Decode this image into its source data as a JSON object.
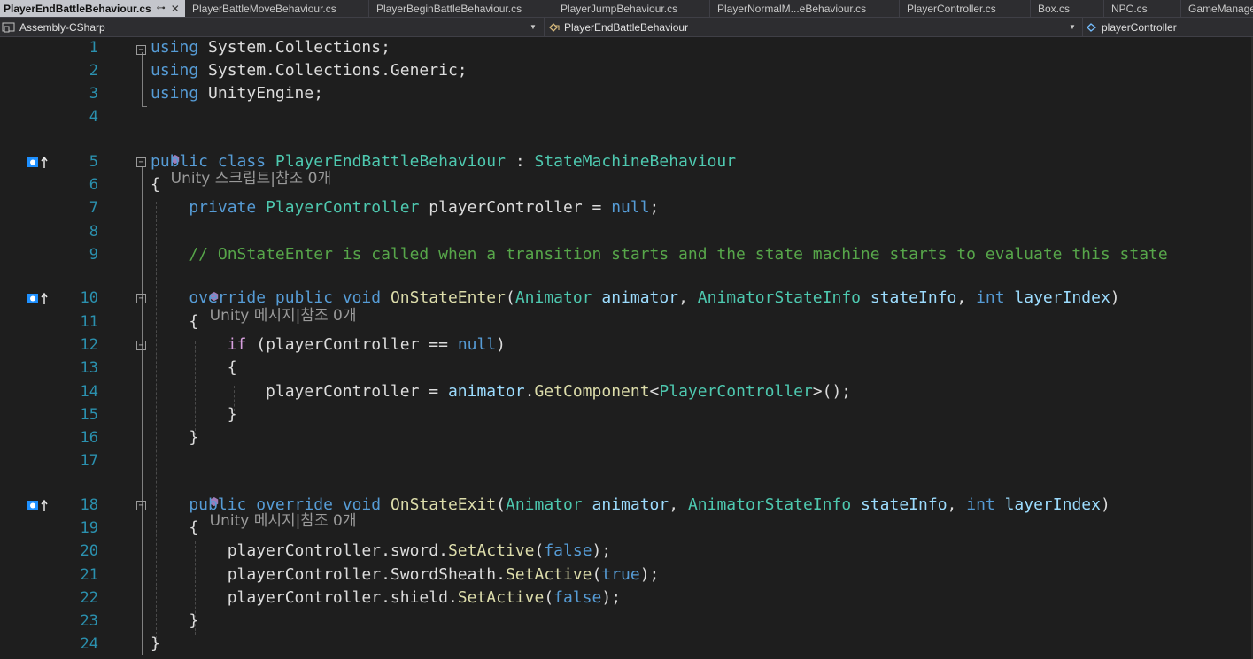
{
  "tabs": [
    {
      "label": "PlayerEndBattleBehaviour.cs",
      "active": true,
      "pin": "⊶",
      "close": "✕"
    },
    {
      "label": "PlayerBattleMoveBehaviour.cs"
    },
    {
      "label": "PlayerBeginBattleBehaviour.cs"
    },
    {
      "label": "PlayerJumpBehaviour.cs"
    },
    {
      "label": "PlayerNormalM...eBehaviour.cs"
    },
    {
      "label": "PlayerController.cs"
    },
    {
      "label": "Box.cs"
    },
    {
      "label": "NPC.cs"
    },
    {
      "label": "GameManage"
    }
  ],
  "nav": {
    "project": "Assembly-CSharp",
    "class": "PlayerEndBattleBehaviour",
    "member": "playerController"
  },
  "codelens": {
    "class": "Unity 스크립트|참조 0개",
    "enter": "Unity 메시지|참조 0개",
    "exit": "Unity 메시지|참조 0개"
  },
  "line_numbers": [
    "1",
    "2",
    "3",
    "4",
    "5",
    "6",
    "7",
    "8",
    "9",
    "10",
    "11",
    "12",
    "13",
    "14",
    "15",
    "16",
    "17",
    "18",
    "19",
    "20",
    "21",
    "22",
    "23",
    "24"
  ],
  "code": {
    "l1": [
      "using",
      " System.Collections;"
    ],
    "l2": [
      "using",
      " System.Collections.Generic;"
    ],
    "l3": [
      "using",
      " UnityEngine;"
    ],
    "l5": [
      "public class ",
      "PlayerEndBattleBehaviour",
      " : ",
      "StateMachineBehaviour"
    ],
    "l6": [
      "{"
    ],
    "l7": [
      "    private ",
      "PlayerController",
      " playerController = ",
      "null",
      ";"
    ],
    "l9": [
      "    // OnStateEnter is called when a transition starts and the state machine starts to evaluate this state"
    ],
    "l10": [
      "    override public void ",
      "OnStateEnter",
      "(",
      "Animator",
      " animator",
      ", ",
      "AnimatorStateInfo",
      " stateInfo",
      ", ",
      "int",
      " layerIndex",
      ")"
    ],
    "l11": [
      "    {"
    ],
    "l12": [
      "        ",
      "if",
      " (playerController == ",
      "null",
      ")"
    ],
    "l13": [
      "        {"
    ],
    "l14": [
      "            playerController = ",
      "animator",
      ".",
      "GetComponent",
      "<",
      "PlayerController",
      ">();"
    ],
    "l15": [
      "        }"
    ],
    "l16": [
      "    }"
    ],
    "l18": [
      "    public override void ",
      "OnStateExit",
      "(",
      "Animator",
      " animator",
      ", ",
      "AnimatorStateInfo",
      " stateInfo",
      ", ",
      "int",
      " layerIndex",
      ")"
    ],
    "l19": [
      "    {"
    ],
    "l20": [
      "        playerController.sword.",
      "SetActive",
      "(",
      "false",
      ");"
    ],
    "l21": [
      "        playerController.SwordSheath.",
      "SetActive",
      "(",
      "true",
      ");"
    ],
    "l22": [
      "        playerController.shield.",
      "SetActive",
      "(",
      "false",
      ");"
    ],
    "l23": [
      "    }"
    ],
    "l24": [
      "}"
    ]
  },
  "colors": {
    "keyword": "#569cd6",
    "type": "#4ec9b0",
    "method": "#dcdcaa",
    "comment": "#57a64a",
    "parameter": "#9cdcfe",
    "line_number": "#2b91af",
    "background": "#1e1e1e"
  },
  "icons": {
    "gutter": "unity-message-override-icon",
    "codelens": "unity-cube-icon"
  }
}
